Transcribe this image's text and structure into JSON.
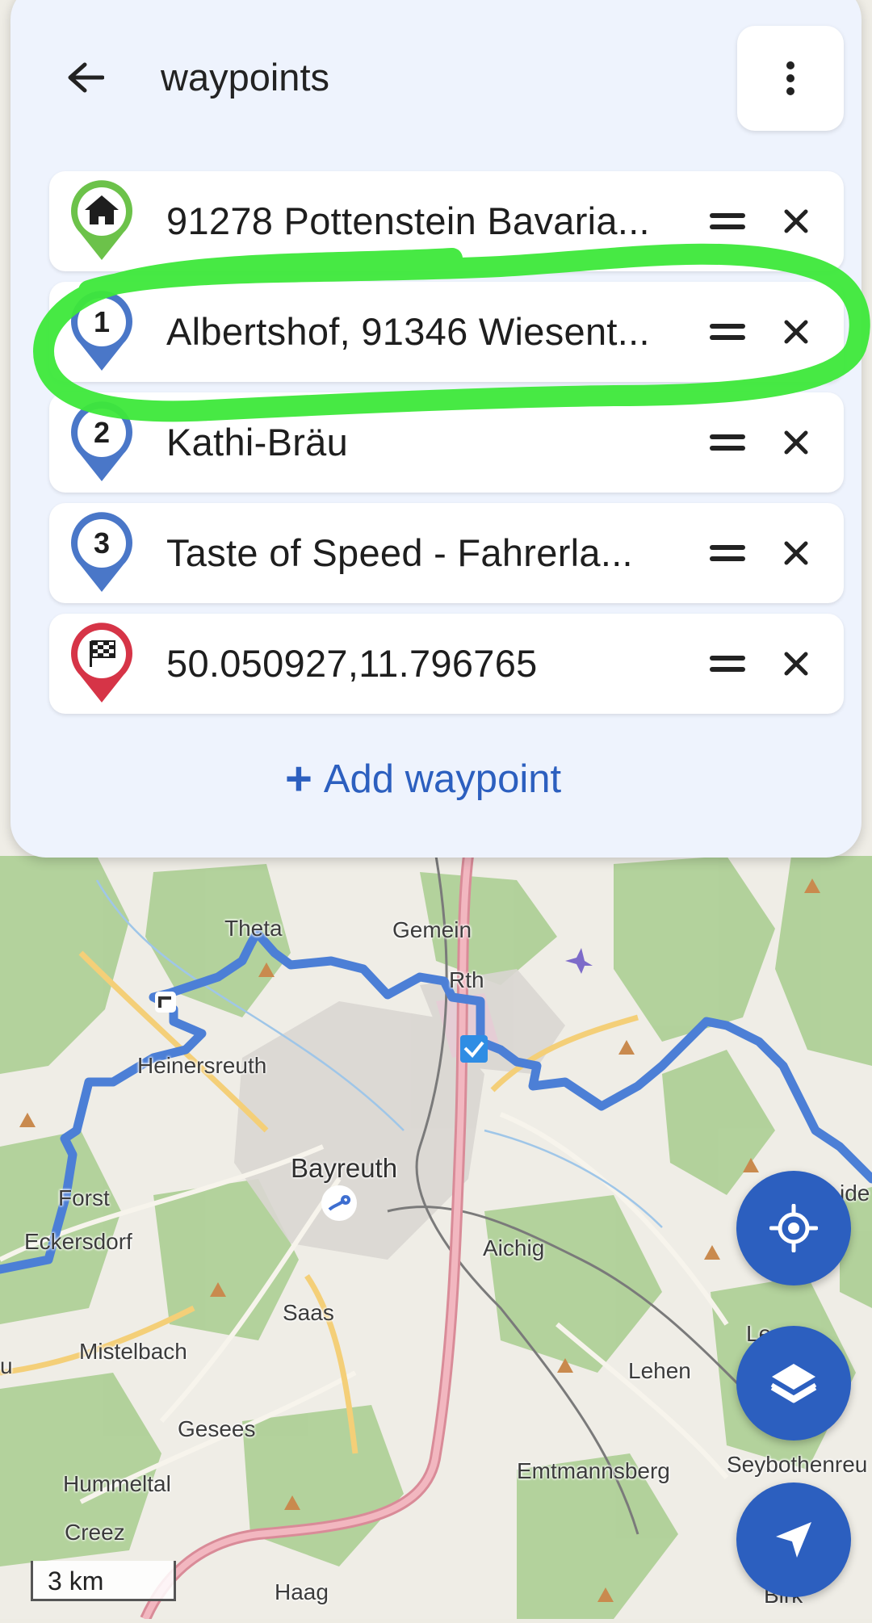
{
  "header": {
    "title": "waypoints"
  },
  "waypoints": [
    {
      "label": "91278 Pottenstein Bavaria...",
      "marker": "home-icon",
      "pin_color": "#6cc24a"
    },
    {
      "label": "Albertshof, 91346 Wiesent...",
      "marker": "1",
      "pin_color": "#4a77c8"
    },
    {
      "label": "Kathi-Bräu",
      "marker": "2",
      "pin_color": "#4a77c8"
    },
    {
      "label": "Taste of Speed - Fahrerla...",
      "marker": "3",
      "pin_color": "#4a77c8"
    },
    {
      "label": "50.050927,11.796765",
      "marker": "checkered-flag-icon",
      "pin_color": "#d63447"
    }
  ],
  "add_waypoint": {
    "label": "Add waypoint"
  },
  "map": {
    "labels": {
      "theta": "Theta",
      "gemein": "Gemein",
      "roth": "Rth",
      "heinersreuth": "Heinersreuth",
      "bayreuth": "Bayreuth",
      "forst": "Forst",
      "eckersdorf": "Eckersdorf",
      "aichig": "Aichig",
      "saas": "Saas",
      "mistelbach": "Mistelbach",
      "gesees": "Gesees",
      "lehen": "Lehen",
      "hummeltal": "Hummeltal",
      "emtmannsberg": "Emtmannsberg",
      "seybothenreuth": "Seybothenreu",
      "creez": "Creez",
      "haag": "Haag",
      "birk": "Birk",
      "le": "Le",
      "ide": "ide",
      "u": "u"
    },
    "route_color": "#4c7fd6",
    "highlight_color": "#3de83a"
  },
  "scale": {
    "label": "3 km"
  },
  "fabs": {
    "locate_icon": "crosshair-icon",
    "layers_icon": "layers-icon",
    "navigate_icon": "navigation-arrow-icon"
  }
}
